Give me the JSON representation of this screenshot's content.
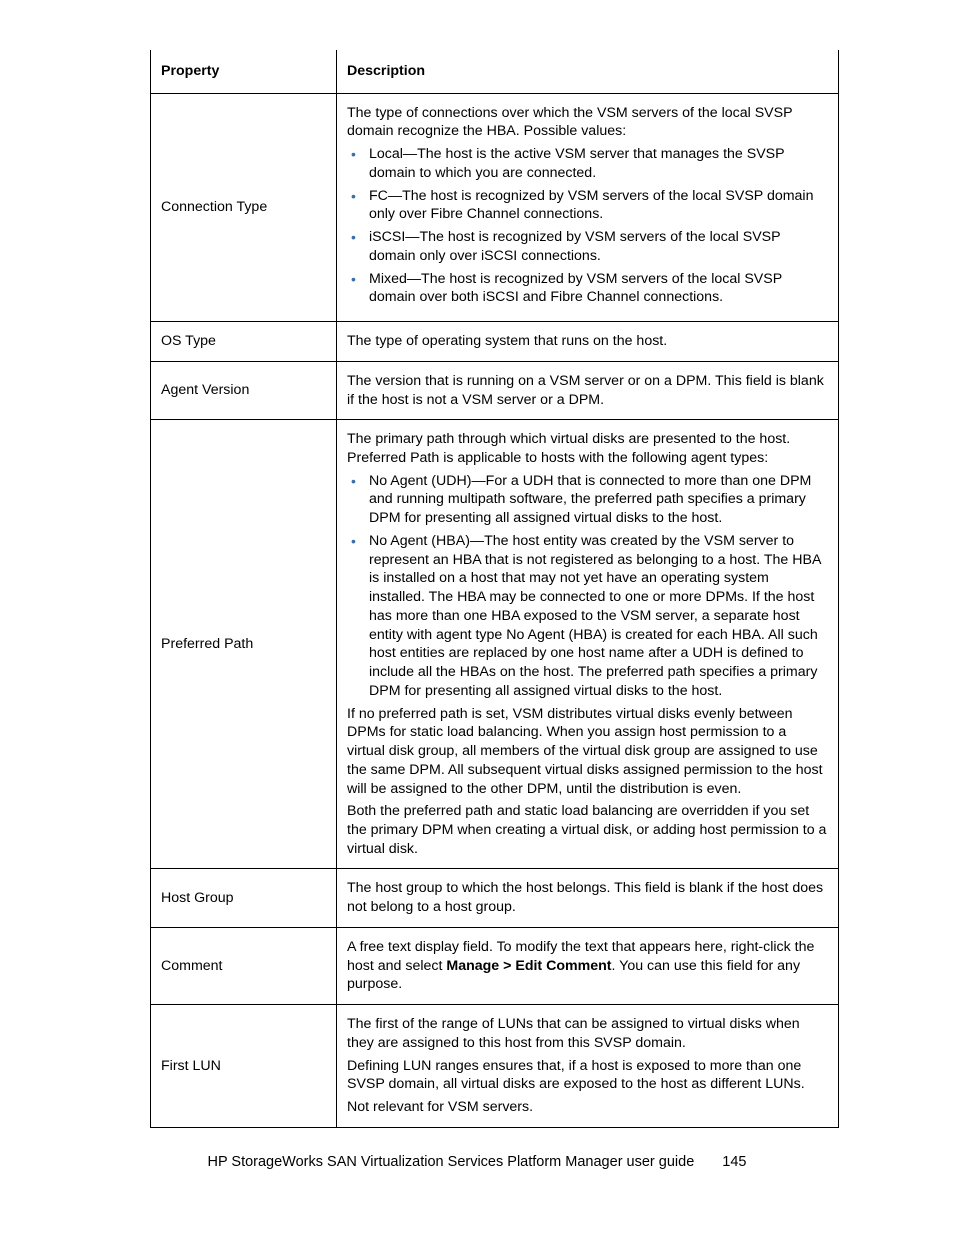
{
  "table": {
    "headers": {
      "property": "Property",
      "description": "Description"
    },
    "rows": {
      "connection_type": {
        "name": "Connection Type",
        "intro": "The type of connections over which the VSM servers of the local SVSP domain recognize the HBA. Possible values:",
        "bullets": [
          "Local—The host is the active VSM server that manages the SVSP domain to which you are connected.",
          "FC—The host is recognized by VSM servers of the local SVSP domain only over Fibre Channel connections.",
          "iSCSI—The host is recognized by VSM servers of the local SVSP domain only over iSCSI connections.",
          "Mixed—The host is recognized by VSM servers of the local SVSP domain over both iSCSI and Fibre Channel connections."
        ]
      },
      "os_type": {
        "name": "OS Type",
        "text": "The type of operating system that runs on the host."
      },
      "agent_version": {
        "name": "Agent Version",
        "text": "The version that is running on a VSM server or on a DPM. This field is blank if the host is not a VSM server or a DPM."
      },
      "preferred_path": {
        "name": "Preferred Path",
        "intro": "The primary path through which virtual disks are presented to the host. Preferred Path is applicable to hosts with the following agent types:",
        "bullets": [
          "No Agent (UDH)—For a UDH that is connected to more than one DPM and running multipath software, the preferred path specifies a primary DPM for presenting all assigned virtual disks to the host.",
          "No Agent (HBA)—The host entity was created by the VSM server to represent an HBA that is not registered as belonging to a host. The HBA is installed on a host that may not yet have an operating system installed. The HBA may be connected to one or more DPMs. If the host has more than one HBA exposed to the VSM server, a separate host entity with agent type No Agent (HBA) is created for each HBA. All such host entities are replaced by one host name after a UDH is defined to include all the HBAs on the host. The preferred path specifies a primary DPM for presenting all assigned virtual disks to the host."
        ],
        "p2": "If no preferred path is set, VSM distributes virtual disks evenly between DPMs for static load balancing. When you assign host permission to a virtual disk group, all members of the virtual disk group are assigned to use the same DPM. All subsequent virtual disks assigned permission to the host will be assigned to the other DPM, until the distribution is even.",
        "p3": "Both the preferred path and static load balancing are overridden if you set the primary DPM when creating a virtual disk, or adding host permission to a virtual disk."
      },
      "host_group": {
        "name": "Host Group",
        "text": "The host group to which the host belongs. This field is blank if the host does not belong to a host group."
      },
      "comment": {
        "name": "Comment",
        "pre": "A free text display field. To modify the text that appears here, right-click the host and select ",
        "bold": "Manage > Edit Comment",
        "post": ". You can use this field for any purpose."
      },
      "first_lun": {
        "name": "First LUN",
        "p1": "The first of the range of LUNs that can be assigned to virtual disks when they are assigned to this host from this SVSP domain.",
        "p2": "Defining LUN ranges ensures that, if a host is exposed to more than one SVSP domain, all virtual disks are exposed to the host as different LUNs.",
        "p3": "Not relevant for VSM servers."
      }
    }
  },
  "footer": {
    "title": "HP StorageWorks SAN Virtualization Services Platform Manager user guide",
    "page": "145"
  }
}
